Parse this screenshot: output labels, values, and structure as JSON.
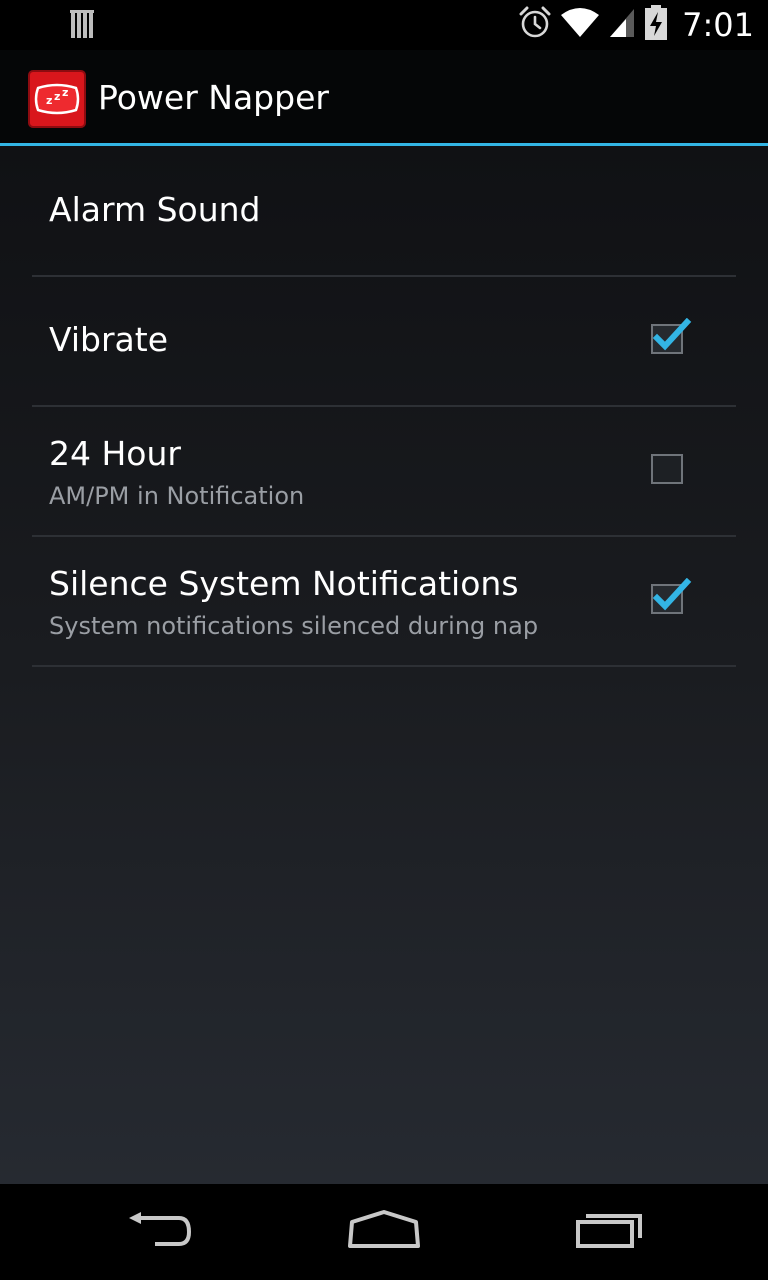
{
  "status_bar": {
    "time": "7:01",
    "icons": [
      "notification-bars-icon",
      "alarm-clock-icon",
      "wifi-icon",
      "cell-signal-icon",
      "battery-charging-icon"
    ]
  },
  "action_bar": {
    "title": "Power Napper",
    "app_icon": "pillow-zzz-icon"
  },
  "preferences": [
    {
      "title": "Alarm Sound",
      "summary": null,
      "checkbox": null
    },
    {
      "title": "Vibrate",
      "summary": null,
      "checkbox": true
    },
    {
      "title": "24 Hour",
      "summary": "AM/PM in Notification",
      "checkbox": false
    },
    {
      "title": "Silence System Notifications",
      "summary": "System notifications silenced during nap",
      "checkbox": true
    }
  ],
  "nav_bar": {
    "buttons": [
      "back-icon",
      "home-icon",
      "recent-apps-icon"
    ]
  },
  "colors": {
    "accent": "#33b5e5",
    "app_icon_red": "#d9161c"
  }
}
